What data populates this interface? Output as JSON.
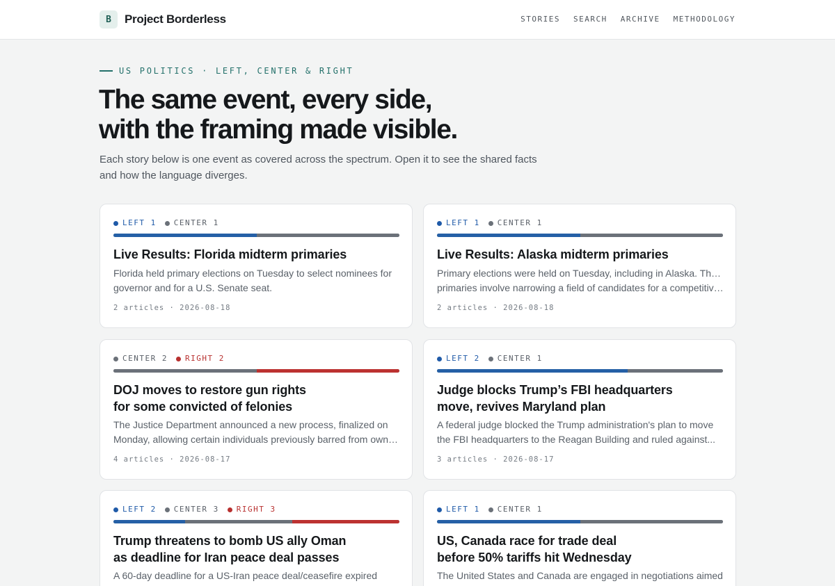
{
  "brand": {
    "logo_letter": "B",
    "name": "Project Borderless"
  },
  "nav": {
    "items": [
      "STORIES",
      "SEARCH",
      "ARCHIVE",
      "METHODOLOGY"
    ]
  },
  "hero": {
    "kicker": "US POLITICS · LEFT, CENTER & RIGHT",
    "headline_line1": "The same event, every side,",
    "headline_line2": "with the framing made visible.",
    "intro": "Each story below is one event as covered across the spectrum. Open it to see the shared facts and how the language diverges."
  },
  "colors": {
    "left": "#2560a6",
    "center": "#6b7179",
    "right": "#bc3231",
    "accent": "#23706a"
  },
  "stories": [
    {
      "coverage": [
        {
          "side": "left",
          "label": "LEFT 1",
          "count": 1
        },
        {
          "side": "center",
          "label": "CENTER 1",
          "count": 1
        }
      ],
      "title_lines": [
        "Live Results: Florida midterm primaries"
      ],
      "summary_lines": [
        "Florida held primary elections on Tuesday to select nominees for",
        "governor and for a U.S. Senate seat."
      ],
      "meta": "2 articles · 2026-08-18"
    },
    {
      "coverage": [
        {
          "side": "left",
          "label": "LEFT 1",
          "count": 1
        },
        {
          "side": "center",
          "label": "CENTER 1",
          "count": 1
        }
      ],
      "title_lines": [
        "Live Results: Alaska midterm primaries"
      ],
      "summary_lines": [
        "Primary elections were held on Tuesday, including in Alaska. These",
        "primaries involve narrowing a field of candidates for a competitive..."
      ],
      "meta": "2 articles · 2026-08-18"
    },
    {
      "coverage": [
        {
          "side": "center",
          "label": "CENTER 2",
          "count": 2
        },
        {
          "side": "right",
          "label": "RIGHT 2",
          "count": 2
        }
      ],
      "title_lines": [
        "DOJ moves to restore gun rights",
        "for some convicted of felonies"
      ],
      "summary_lines": [
        "The Justice Department announced a new process, finalized on",
        "Monday, allowing certain individuals previously barred from owning..."
      ],
      "meta": "4 articles · 2026-08-17"
    },
    {
      "coverage": [
        {
          "side": "left",
          "label": "LEFT 2",
          "count": 2
        },
        {
          "side": "center",
          "label": "CENTER 1",
          "count": 1
        }
      ],
      "title_lines": [
        "Judge blocks Trump’s FBI headquarters",
        "move, revives Maryland plan"
      ],
      "summary_lines": [
        "A federal judge blocked the Trump administration's plan to move",
        "the FBI headquarters to the Reagan Building and ruled against..."
      ],
      "meta": "3 articles · 2026-08-17"
    },
    {
      "coverage": [
        {
          "side": "left",
          "label": "LEFT 2",
          "count": 2
        },
        {
          "side": "center",
          "label": "CENTER 3",
          "count": 3
        },
        {
          "side": "right",
          "label": "RIGHT 3",
          "count": 3
        }
      ],
      "title_lines": [
        "Trump threatens to bomb US ally Oman",
        "as deadline for Iran peace deal passes"
      ],
      "summary_lines": [
        "A 60-day deadline for a US-Iran peace deal/ceasefire expired"
      ],
      "meta": ""
    },
    {
      "coverage": [
        {
          "side": "left",
          "label": "LEFT 1",
          "count": 1
        },
        {
          "side": "center",
          "label": "CENTER 1",
          "count": 1
        }
      ],
      "title_lines": [
        "US, Canada race for trade deal",
        "before 50% tariffs hit Wednesday"
      ],
      "summary_lines": [
        "The United States and Canada are engaged in negotiations aimed"
      ],
      "meta": ""
    }
  ]
}
